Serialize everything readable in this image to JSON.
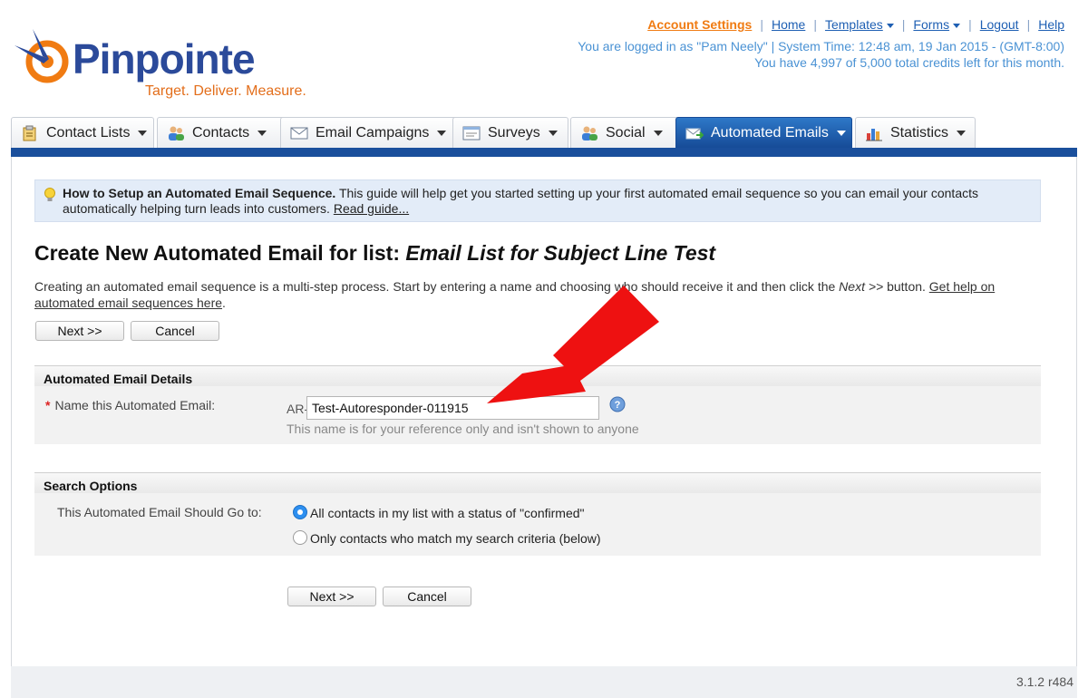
{
  "brand": {
    "name": "Pinpointe",
    "tagline": "Target. Deliver. Measure."
  },
  "topnav": {
    "account_settings": "Account Settings",
    "home": "Home",
    "templates": "Templates",
    "forms": "Forms",
    "logout": "Logout",
    "help": "Help",
    "status_line1": "You are logged in as \"Pam Neely\" | System Time: 12:48 am, 19 Jan 2015 - (GMT-8:00)",
    "status_line2": "You have 4,997 of 5,000 total credits left for this month."
  },
  "tabs": [
    {
      "label": "Contact Lists"
    },
    {
      "label": "Contacts"
    },
    {
      "label": "Email Campaigns"
    },
    {
      "label": "Surveys"
    },
    {
      "label": "Social"
    },
    {
      "label": "Automated Emails"
    },
    {
      "label": "Statistics"
    }
  ],
  "info": {
    "title": "How to Setup an Automated Email Sequence.",
    "text": " This guide will help get you started setting up your first automated email sequence so you can email your contacts automatically helping turn leads into customers. ",
    "link": "Read guide..."
  },
  "page": {
    "title_prefix": "Create New Automated Email for list: ",
    "title_list": "Email List for Subject Line Test",
    "intro_a": "Creating an automated email sequence is a multi-step process. Start by entering a name and choosing who should receive it and then click the ",
    "intro_next": "Next >>",
    "intro_b": " button. ",
    "intro_link": "Get help on automated email sequences here",
    "intro_end": "."
  },
  "buttons": {
    "next": "Next >>",
    "cancel": "Cancel"
  },
  "details": {
    "heading": "Automated Email Details",
    "name_label": "Name this Automated Email:",
    "prefix": "AR-",
    "name_value": "Test-Autoresponder-011915",
    "hint": "This name is for your reference only and isn't shown to anyone"
  },
  "search": {
    "heading": "Search Options",
    "label": "This Automated Email Should Go to:",
    "option_all": "All contacts in my list with a status of \"confirmed\"",
    "option_criteria": "Only contacts who match my search criteria (below)",
    "selected": "all"
  },
  "footer": {
    "version": "3.1.2 r484"
  },
  "colors": {
    "brand_blue": "#2b4a9a",
    "brand_orange": "#e36e1b",
    "active_tab": "#1a4f9c",
    "arrow": "#ee1111"
  }
}
